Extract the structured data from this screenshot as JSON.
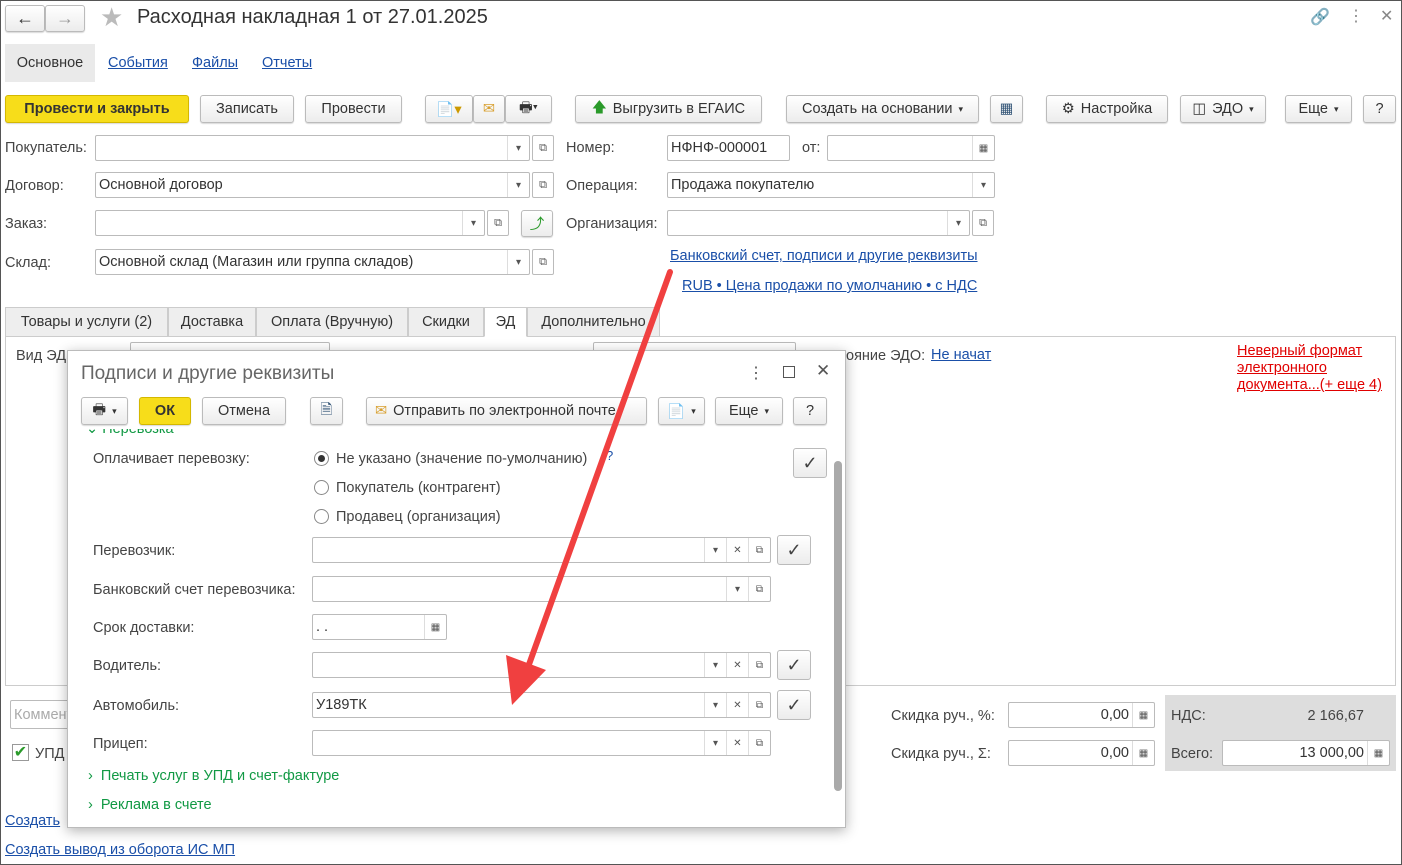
{
  "window": {
    "title": "Расходная накладная 1 от 27.01.2025"
  },
  "nav": {
    "tabs": [
      "Основное",
      "События",
      "Файлы",
      "Отчеты"
    ]
  },
  "toolbar": {
    "post_close": "Провести и закрыть",
    "save": "Записать",
    "post": "Провести",
    "egais": "Выгрузить в ЕГАИС",
    "create_based": "Создать на основании",
    "settings": "Настройка",
    "edo": "ЭДО",
    "more": "Еще",
    "help": "?"
  },
  "form": {
    "buyer": {
      "label": "Покупатель:",
      "value": ""
    },
    "contract": {
      "label": "Договор:",
      "value": "Основной договор"
    },
    "order": {
      "label": "Заказ:",
      "value": ""
    },
    "warehouse": {
      "label": "Склад:",
      "value": "Основной склад (Магазин или группа складов)"
    },
    "number": {
      "label": "Номер:",
      "value": "НФНФ-000001"
    },
    "date": {
      "label": "от:",
      "value": ""
    },
    "operation": {
      "label": "Операция:",
      "value": "Продажа покупателю"
    },
    "organization": {
      "label": "Организация:",
      "value": ""
    },
    "bank_link": "Банковский счет, подписи и другие реквизиты",
    "price_link": "RUB • Цена продажи по умолчанию • с НДС"
  },
  "doc_tabs": [
    "Товары и услуги (2)",
    "Доставка",
    "Оплата (Вручную)",
    "Скидки",
    "ЭД",
    "Дополнительно"
  ],
  "ed_panel": {
    "kind_label": "Вид ЭД",
    "state_label": "ояние ЭДО:",
    "state_value": "Не начат",
    "error_link": "Неверный формат электронного документа...(+ еще 4)"
  },
  "footer": {
    "comment_placeholder": "Комментарий",
    "upd_label": "УПД",
    "create_link": "Создать",
    "create_withdraw_link": "Создать вывод из оборота ИС МП",
    "discount_pct_label": "Скидка руч., %:",
    "discount_pct": "0,00",
    "discount_sum_label": "Скидка руч., Σ:",
    "discount_sum": "0,00",
    "vat_label": "НДС:",
    "vat": "2 166,67",
    "total_label": "Всего:",
    "total": "13 000,00"
  },
  "dialog": {
    "title": "Подписи и другие реквизиты",
    "ok": "ОК",
    "cancel": "Отмена",
    "send_email": "Отправить по электронной почте",
    "more": "Еще",
    "help": "?",
    "section": "Перевозка",
    "payer_label": "Оплачивает перевозку:",
    "payer_options": [
      "Не указано (значение по-умолчанию)",
      "Покупатель (контрагент)",
      "Продавец (организация)"
    ],
    "payer_selected": 0,
    "carrier_label": "Перевозчик:",
    "carrier": "",
    "carrier_bank_label": "Банковский счет перевозчика:",
    "carrier_bank": "",
    "delivery_label": "Срок доставки:",
    "delivery": " .  .",
    "driver_label": "Водитель:",
    "driver": "",
    "car_label": "Автомобиль:",
    "car": "У189ТК",
    "trailer_label": "Прицеп:",
    "trailer": "",
    "print_services": "Печать услуг в УПД и счет-фактуре",
    "ads": "Реклама в счете"
  },
  "colors": {
    "accent_yellow": "#f7dd1a",
    "link": "#1a4fa8",
    "error": "#e00000",
    "green": "#119944",
    "arrow": "#f04040"
  }
}
